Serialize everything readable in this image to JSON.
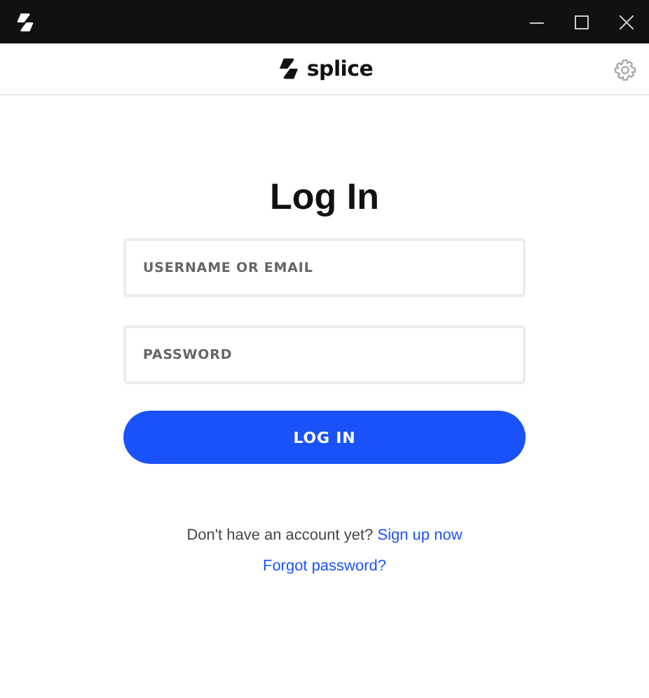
{
  "header": {
    "logo_text": "splice"
  },
  "form": {
    "title": "Log In",
    "fields": [
      {
        "placeholder": "USERNAME OR EMAIL"
      },
      {
        "placeholder": "PASSWORD"
      }
    ],
    "submit": "LOG IN"
  },
  "signup": {
    "prompt": "Don't have an account yet?",
    "link": "Sign up now"
  },
  "forgot_link": "Forgot password?"
}
